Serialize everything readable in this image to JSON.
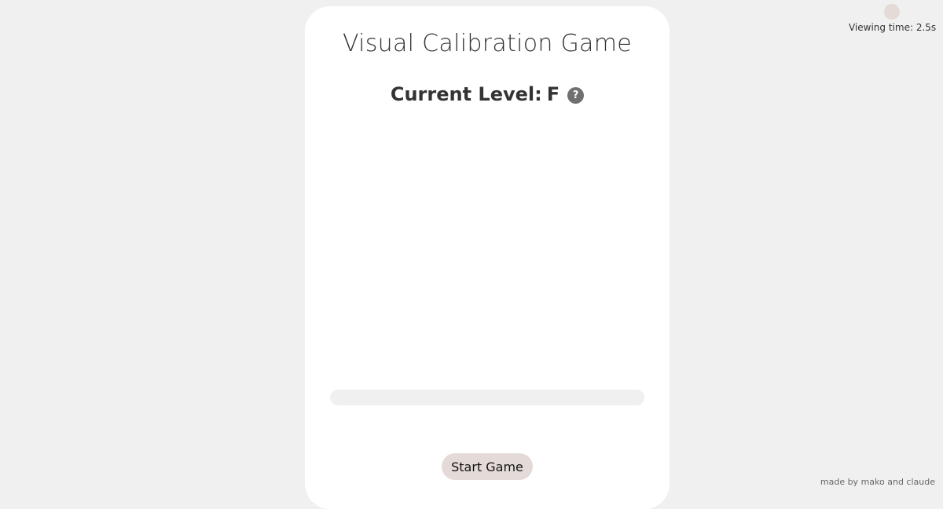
{
  "game": {
    "title": "Visual Calibration Game",
    "level_label": "Current Level:",
    "level_value": "F",
    "help_icon": "question-mark-icon",
    "help_glyph": "?",
    "progress_fraction": 0,
    "start_label": "Start Game"
  },
  "timer": {
    "label": "Viewing time: 2.5s"
  },
  "footer": {
    "credit": "made by mako and claude"
  },
  "colors": {
    "page_background": "#f0f0f0",
    "card_background": "#ffffff",
    "button_background": "#e4dad7",
    "help_icon_background": "#707070",
    "progress_track": "#f0f0f0",
    "text": "#333333"
  }
}
